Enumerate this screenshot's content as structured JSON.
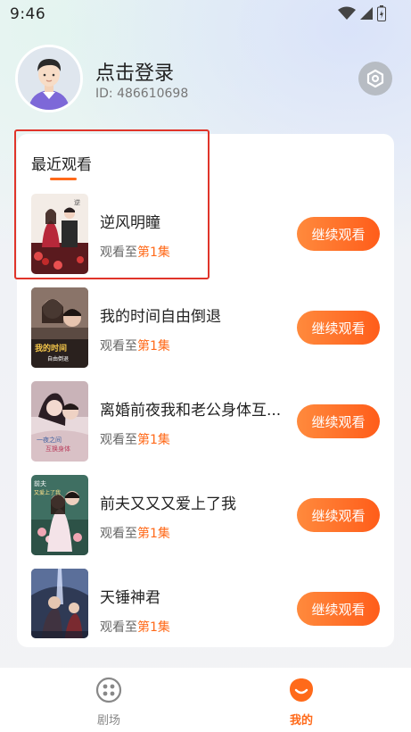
{
  "status_bar": {
    "time": "9:46"
  },
  "profile": {
    "login_label": "点击登录",
    "user_id": "ID: 486610698"
  },
  "icons": {
    "settings": "settings-hex-icon",
    "wifi": "wifi-icon",
    "signal": "signal-icon",
    "battery": "battery-charging-icon"
  },
  "recent": {
    "section_title": "最近观看",
    "items": [
      {
        "title": "逆风明瞳",
        "progress_prefix": "观看至",
        "episode": "第1集",
        "button": "继续观看"
      },
      {
        "title": "我的时间自由倒退",
        "progress_prefix": "观看至",
        "episode": "第1集",
        "button": "继续观看"
      },
      {
        "title": "离婚前夜我和老公身体互...",
        "progress_prefix": "观看至",
        "episode": "第1集",
        "button": "继续观看"
      },
      {
        "title": "前夫又又又爱上了我",
        "progress_prefix": "观看至",
        "episode": "第1集",
        "button": "继续观看"
      },
      {
        "title": "天锤神君",
        "progress_prefix": "观看至",
        "episode": "第1集",
        "button": "继续观看"
      }
    ]
  },
  "tabbar": {
    "tabs": [
      {
        "label": "剧场",
        "icon": "theater-icon",
        "active": false
      },
      {
        "label": "我的",
        "icon": "mine-icon",
        "active": true
      }
    ]
  },
  "colors": {
    "accent": "#ff6a1a",
    "highlight_border": "#e0342a"
  }
}
